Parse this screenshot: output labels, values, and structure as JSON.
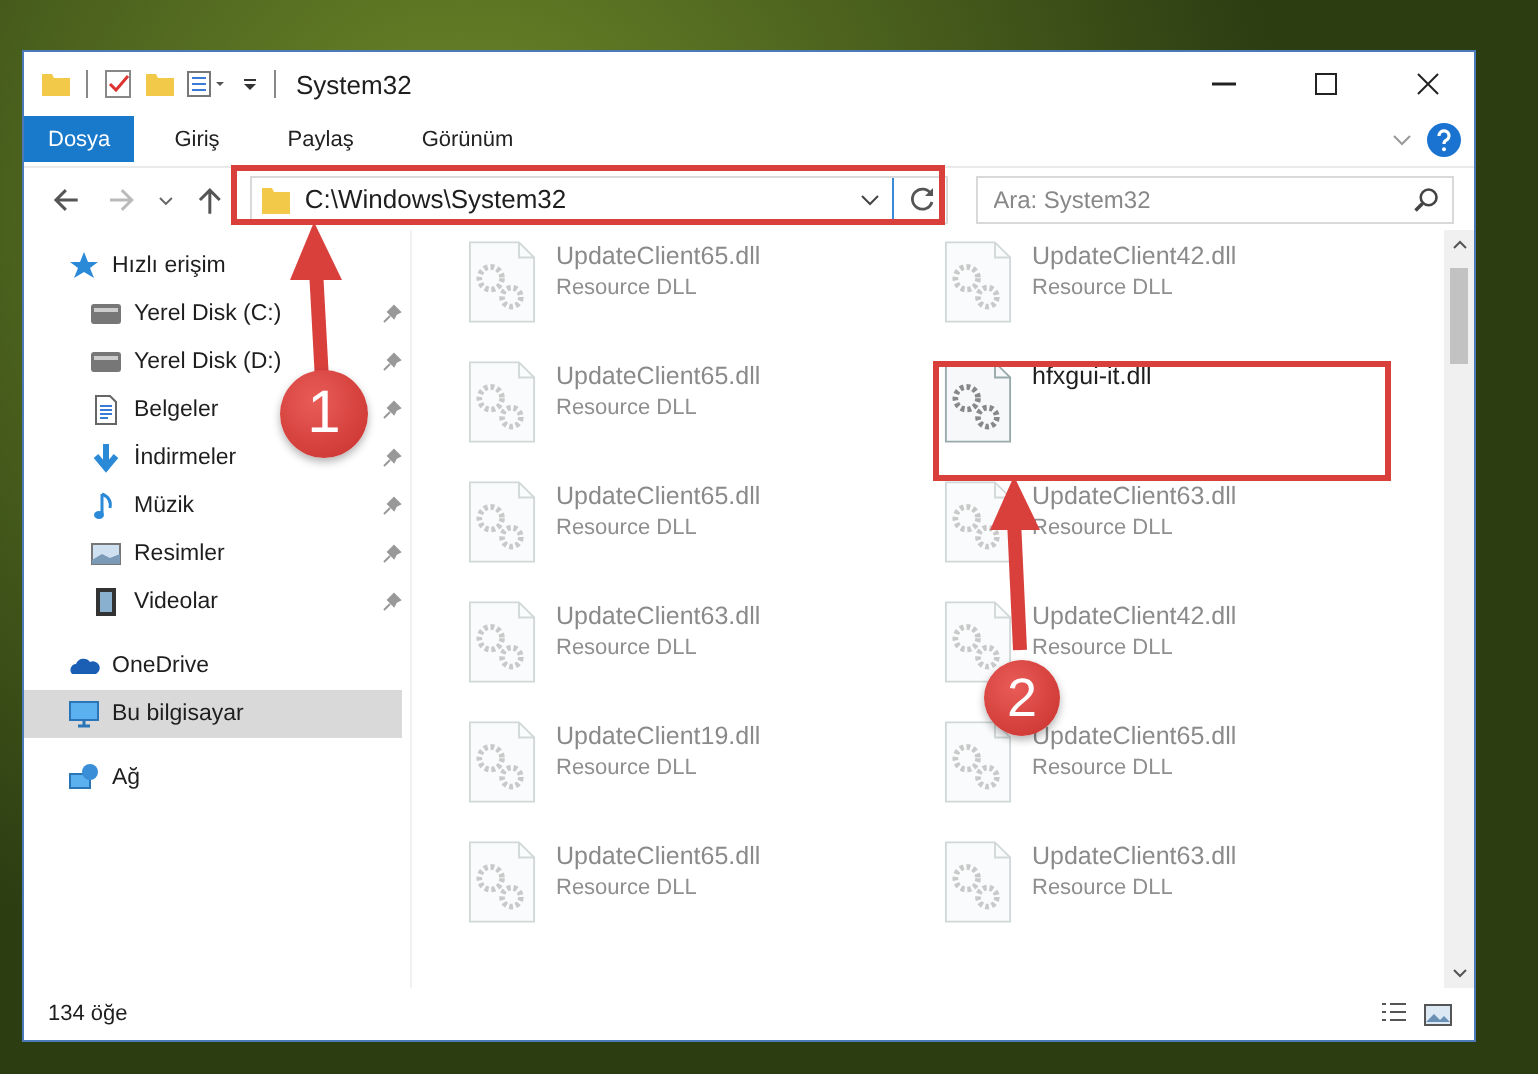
{
  "window": {
    "title": "System32"
  },
  "ribbon_tabs": [
    {
      "label": "Dosya",
      "selected": true
    },
    {
      "label": "Giriş",
      "selected": false
    },
    {
      "label": "Paylaş",
      "selected": false
    },
    {
      "label": "Görünüm",
      "selected": false
    }
  ],
  "address_bar": {
    "path": "C:\\Windows\\System32"
  },
  "search": {
    "placeholder": "Ara: System32"
  },
  "sidebar": {
    "items": [
      {
        "label": "Hızlı erişim",
        "kind": "star",
        "selected": false,
        "children": [
          {
            "label": "Yerel Disk (C:)",
            "kind": "drive",
            "pinned": true,
            "selected": false
          },
          {
            "label": "Yerel Disk (D:)",
            "kind": "drive",
            "pinned": true,
            "selected": false
          },
          {
            "label": "Belgeler",
            "kind": "document",
            "pinned": true,
            "selected": false
          },
          {
            "label": "İndirmeler",
            "kind": "download",
            "pinned": true,
            "selected": false
          },
          {
            "label": "Müzik",
            "kind": "music",
            "pinned": true,
            "selected": false
          },
          {
            "label": "Resimler",
            "kind": "picture",
            "pinned": true,
            "selected": false
          },
          {
            "label": "Videolar",
            "kind": "video",
            "pinned": true,
            "selected": false
          }
        ]
      },
      {
        "label": "OneDrive",
        "kind": "cloud",
        "selected": false
      },
      {
        "label": "Bu bilgisayar",
        "kind": "computer",
        "selected": true
      },
      {
        "label": "Ağ",
        "kind": "network",
        "selected": false
      }
    ]
  },
  "files": [
    {
      "name": "UpdateClient65.dll",
      "type": "Resource DLL",
      "dimmed": true
    },
    {
      "name": "UpdateClient42.dll",
      "type": "Resource DLL",
      "dimmed": true
    },
    {
      "name": "UpdateClient65.dll",
      "type": "Resource DLL",
      "dimmed": true
    },
    {
      "name": "hfxgui-it.dll",
      "dimmed": false
    },
    {
      "name": "UpdateClient65.dll",
      "type": "Resource DLL",
      "dimmed": true
    },
    {
      "name": "UpdateClient63.dll",
      "type": "Resource DLL",
      "dimmed": true
    },
    {
      "name": "UpdateClient63.dll",
      "type": "Resource DLL",
      "dimmed": true
    },
    {
      "name": "UpdateClient42.dll",
      "type": "Resource DLL",
      "dimmed": true
    },
    {
      "name": "UpdateClient19.dll",
      "type": "Resource DLL",
      "dimmed": true
    },
    {
      "name": "UpdateClient65.dll",
      "type": "Resource DLL",
      "dimmed": true
    },
    {
      "name": "UpdateClient65.dll",
      "type": "Resource DLL",
      "dimmed": true
    },
    {
      "name": "UpdateClient63.dll",
      "type": "Resource DLL",
      "dimmed": true
    }
  ],
  "status_bar": {
    "item_count": "134 öğe"
  },
  "annotations": [
    {
      "number": "1"
    },
    {
      "number": "2"
    }
  ]
}
